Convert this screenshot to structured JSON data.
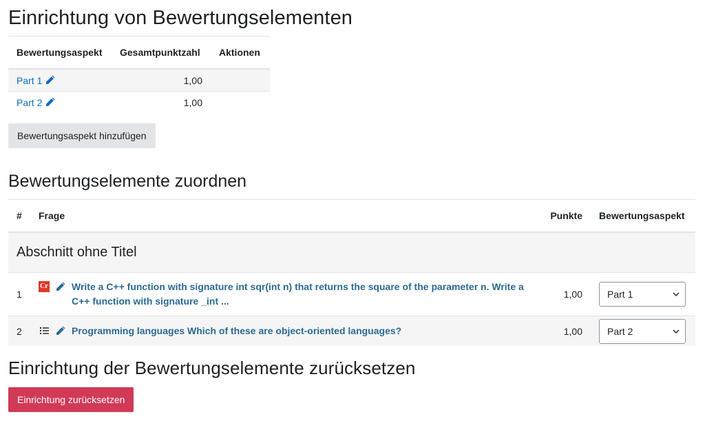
{
  "setup": {
    "title": "Einrichtung von Bewertungselementen",
    "headers": {
      "aspect": "Bewertungsaspekt",
      "total": "Gesamtpunktzahl",
      "actions": "Aktionen"
    },
    "aspects": [
      {
        "name": "Part 1",
        "total": "1,00"
      },
      {
        "name": "Part 2",
        "total": "1,00"
      }
    ],
    "add_button": "Bewertungsaspekt hinzufügen"
  },
  "mapping": {
    "title": "Bewertungselemente zuordnen",
    "headers": {
      "number": "#",
      "question": "Frage",
      "points": "Punkte",
      "aspect": "Bewertungsaspekt"
    },
    "section_title": "Abschnitt ohne Titel",
    "questions": [
      {
        "number": "1",
        "type_icon": "coderunner-icon",
        "type_icon_text": "Cr",
        "text": "Write a C++ function with signature int sqr(int n) that returns the square of the parameter n. Write a C++ function with signature _int ...",
        "points": "1,00",
        "aspect": "Part 1"
      },
      {
        "number": "2",
        "type_icon": "multichoice-list-icon",
        "text": "Programming languages Which of these are object-oriented languages?",
        "points": "1,00",
        "aspect": "Part 2"
      }
    ]
  },
  "reset": {
    "title": "Einrichtung der Bewertungselemente zurücksetzen",
    "button": "Einrichtung zurücksetzen"
  },
  "colors": {
    "link": "#0f6cbf",
    "question_link": "#2b6a93",
    "danger": "#d13a56",
    "secondary": "#e2e5e8",
    "stripe": "#f5f5f5"
  }
}
